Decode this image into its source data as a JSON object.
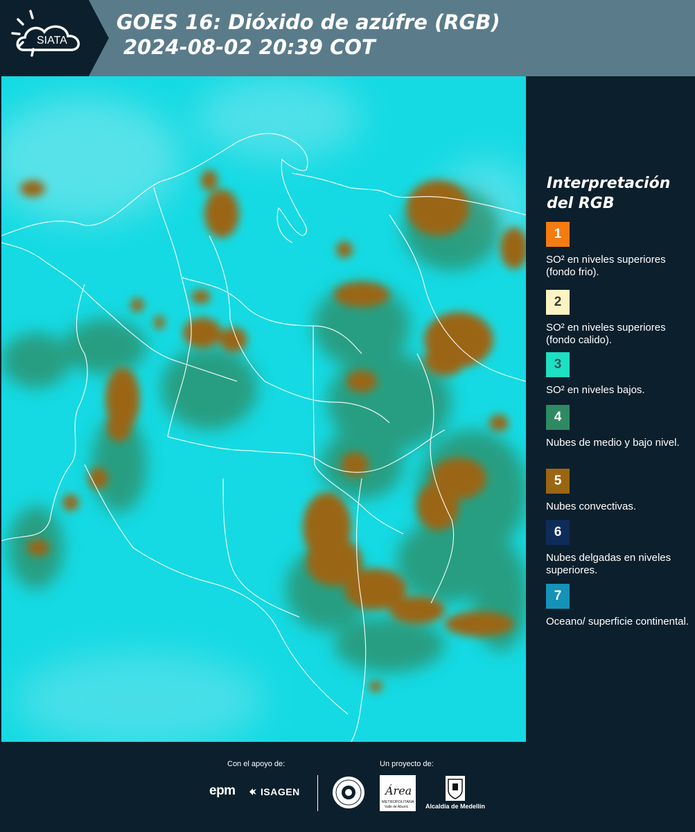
{
  "header": {
    "logo_text": "SIATA",
    "title_line1": "GOES 16: Dióxido de azúfre (RGB)",
    "title_line2": "2024-08-02 20:39 COT"
  },
  "legend": {
    "title": "Interpretación del RGB",
    "items": [
      {
        "number": "1",
        "color": "#f47c12",
        "text_color": "#ffffff",
        "label": "SO² en niveles superiores (fondo frio)."
      },
      {
        "number": "2",
        "color": "#fdf4c4",
        "text_color": "#3a3a3a",
        "label": "SO² en niveles superiores (fondo calido)."
      },
      {
        "number": "3",
        "color": "#1de0c2",
        "text_color": "#2a5a5a",
        "label": "SO² en niveles bajos."
      },
      {
        "number": "4",
        "color": "#2e8a62",
        "text_color": "#ffffff",
        "label": "Nubes de medio y bajo nivel."
      },
      {
        "number": "5",
        "color": "#9a6612",
        "text_color": "#ffffff",
        "label": "Nubes convectivas."
      },
      {
        "number": "6",
        "color": "#0e2c5a",
        "text_color": "#ffffff",
        "label": "Nubes delgadas en niveles superiores."
      },
      {
        "number": "7",
        "color": "#1592b8",
        "text_color": "#ffffff",
        "label": "Oceano/ superficie continental."
      }
    ]
  },
  "colors": {
    "map_background": "#15dae3",
    "convective": "#9a6612",
    "mid_low": "#2e8a62",
    "header_bg": "#5a7b8a",
    "panel_bg": "#0c1f2c"
  },
  "footer": {
    "support_label": "Con el apoyo de:",
    "project_label": "Un proyecto de:",
    "epm": "epm",
    "isagen": "ISAGEN",
    "area_name": "Área",
    "area_sub": "METROPOLITANA",
    "area_sub2": "Valle de Aburrá",
    "alcaldia": "Alcaldía de Medellín"
  }
}
